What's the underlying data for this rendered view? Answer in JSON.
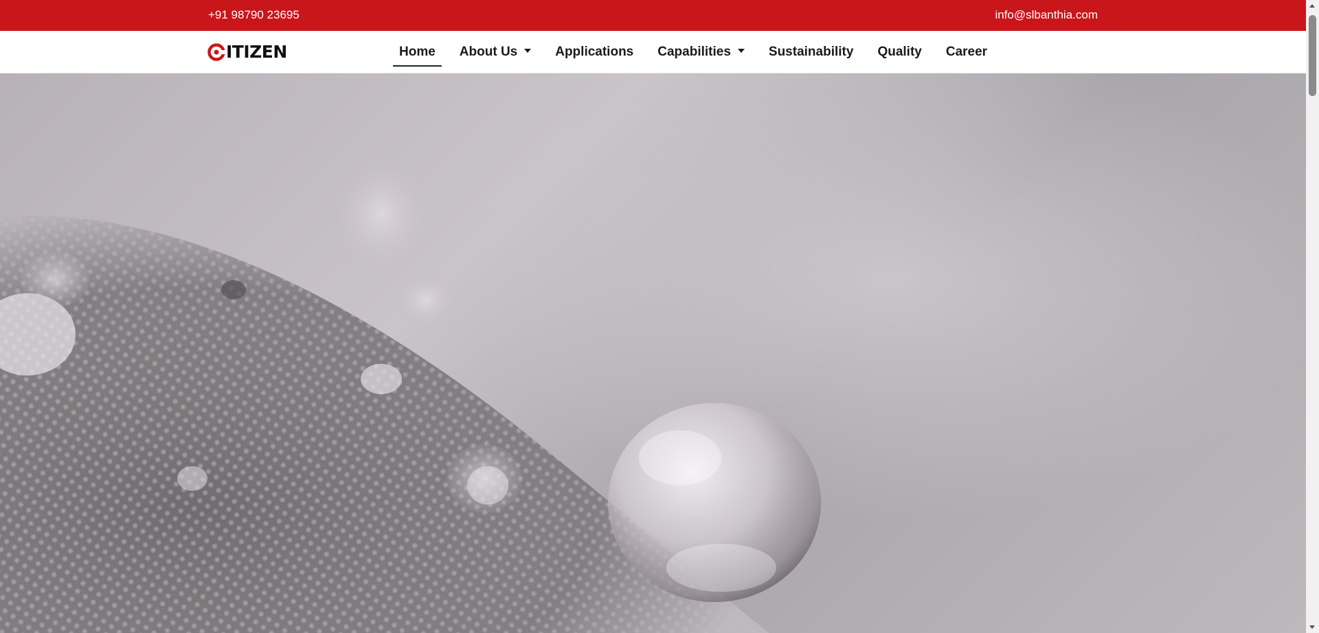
{
  "topbar": {
    "phone": "+91 98790 23695",
    "email": "info@slbanthia.com",
    "bg_color": "#c8161a"
  },
  "brand": {
    "logo_text": "ITIZEN",
    "logo_mark": "C-mark-icon",
    "accent_color": "#c8161a"
  },
  "nav": {
    "items": [
      {
        "label": "Home",
        "active": true,
        "dropdown": false
      },
      {
        "label": "About Us",
        "active": false,
        "dropdown": true
      },
      {
        "label": "Applications",
        "active": false,
        "dropdown": false
      },
      {
        "label": "Capabilities",
        "active": false,
        "dropdown": true
      },
      {
        "label": "Sustainability",
        "active": false,
        "dropdown": false
      },
      {
        "label": "Quality",
        "active": false,
        "dropdown": false
      },
      {
        "label": "Career",
        "active": false,
        "dropdown": false
      }
    ]
  },
  "hero": {
    "image": "water-droplets-on-fabric"
  }
}
